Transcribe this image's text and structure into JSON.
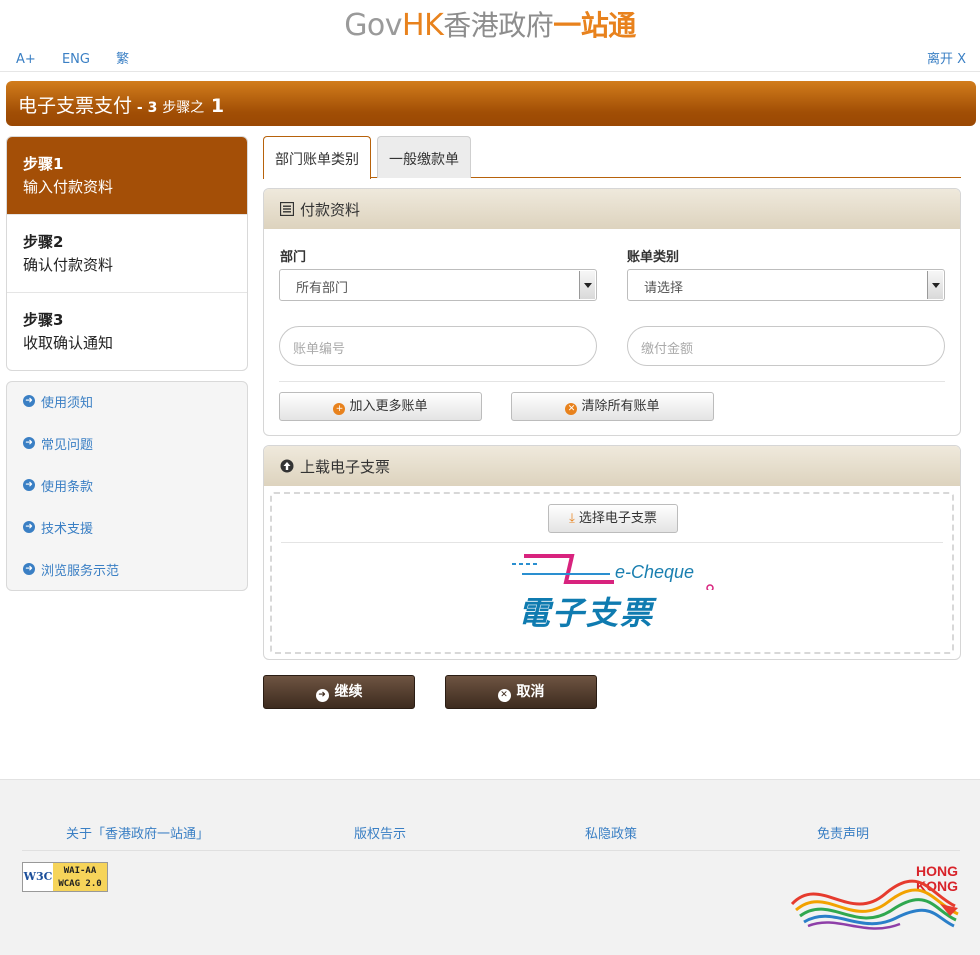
{
  "header": {
    "logo_gov": "Gov",
    "logo_hk": "HK",
    "logo_cn1": "香港政府",
    "logo_cn2": "一站通",
    "font_larger": "A+",
    "lang_eng": "ENG",
    "lang_trad": "繁",
    "leave": "离开 X"
  },
  "title": {
    "main": "电子支票支付",
    "step_prefix": " - 3 ",
    "step_label": "步骤之",
    "step_num": " 1"
  },
  "steps": [
    {
      "title": "步骤1",
      "desc": "输入付款资料"
    },
    {
      "title": "步骤2",
      "desc": "确认付款资料"
    },
    {
      "title": "步骤3",
      "desc": "收取确认通知"
    }
  ],
  "side_links": [
    "使用须知",
    "常见问题",
    "使用条款",
    "技术支援",
    "浏览服务示范"
  ],
  "tabs": [
    "部门账单类别",
    "一般缴款单"
  ],
  "payment_panel": {
    "title": "付款资料",
    "dept_label": "部门",
    "dept_value": "所有部门",
    "bill_type_label": "账单类别",
    "bill_type_value": "请选择",
    "bill_no_placeholder": "账单编号",
    "amount_placeholder": "缴付金额",
    "add_more": "加入更多账单",
    "clear_all": "清除所有账单"
  },
  "upload_panel": {
    "title": "上载电子支票",
    "choose": "选择电子支票",
    "logo_en": "e-Cheque",
    "logo_cn": "電子支票"
  },
  "actions": {
    "continue": "继续",
    "cancel": "取消"
  },
  "footer": {
    "links": [
      "关于「香港政府一站通」",
      "版权告示",
      "私隐政策",
      "免责声明"
    ],
    "w3c": "W3C",
    "wai_line1": "WAI-AA",
    "wai_line2": "WCAG 2.0",
    "brand_line1": "HONG",
    "brand_line2": "KONG"
  },
  "colors": {
    "accent_orange": "#e8821d",
    "title_brown": "#a44f07",
    "link_blue": "#3a7fc4",
    "dark_button": "#4a3526"
  }
}
